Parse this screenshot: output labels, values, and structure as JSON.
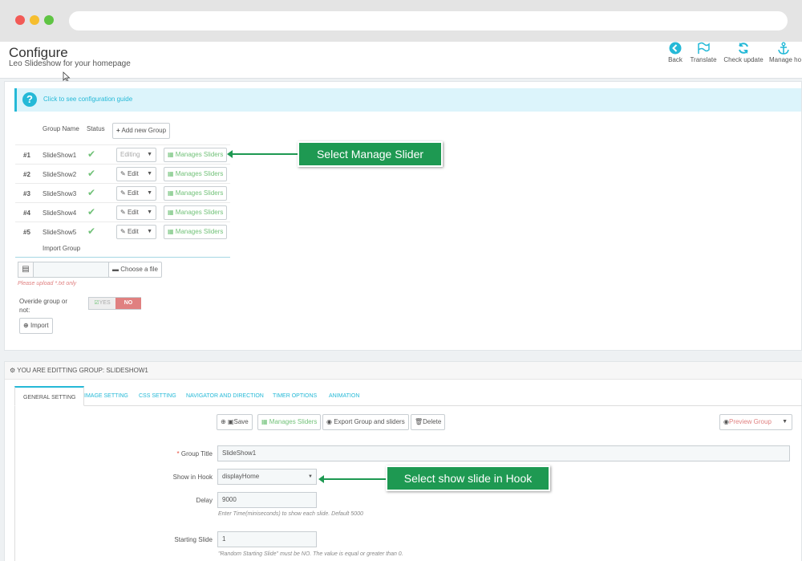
{
  "header": {
    "title": "Configure",
    "subtitle": "Leo Slideshow for your homepage",
    "toolbar": [
      {
        "label": "Back",
        "icon": "back-arrow-icon"
      },
      {
        "label": "Translate",
        "icon": "flag-icon"
      },
      {
        "label": "Check update",
        "icon": "refresh-icon"
      },
      {
        "label": "Manage ho",
        "icon": "anchor-icon"
      }
    ]
  },
  "guide": {
    "link": "Click to see configuration guide"
  },
  "groups": {
    "col_name": "Group Name",
    "col_status": "Status",
    "add_label": "Add new Group",
    "editing_label": "Editing",
    "edit_label": "Edit",
    "manage_label": "Manages Sliders",
    "rows": [
      {
        "num": "#1",
        "name": "SlideShow1"
      },
      {
        "num": "#2",
        "name": "SlideShow2"
      },
      {
        "num": "#3",
        "name": "SlideShow3"
      },
      {
        "num": "#4",
        "name": "SlideShow4"
      },
      {
        "num": "#5",
        "name": "SlideShow5"
      }
    ]
  },
  "import": {
    "title": "Import Group",
    "choose_label": "Choose a file",
    "hint": "Please upload *.txt only",
    "override_label": "Overide group or not:",
    "yes": "YES",
    "no": "NO",
    "import_label": "Import"
  },
  "callouts": {
    "manage": "Select Manage Slider",
    "hook": "Select show slide in Hook"
  },
  "editing": {
    "heading": "YOU ARE EDITTING GROUP: SLIDESHOW1",
    "tabs": [
      "GENERAL SETTING",
      "IMAGE SETTING",
      "CSS SETTING",
      "NAVIGATOR AND DIRECTION",
      "TIMER OPTIONS",
      "ANIMATION"
    ],
    "actions": {
      "save": "Save",
      "manage": "Manages Sliders",
      "export": "Export Group and sliders",
      "delete": "Delete",
      "preview": "Preview Group"
    },
    "fields": {
      "group_title_label": "Group Title",
      "group_title_value": "SlideShow1",
      "hook_label": "Show in Hook",
      "hook_value": "displayHome",
      "delay_label": "Delay",
      "delay_value": "9000",
      "delay_help": "Enter Time(miniseconds) to show each slide. Default 5000",
      "start_label": "Starting Slide",
      "start_value": "1",
      "start_help": "\"Random Starting Slide\" must be NO. The value is equal or greater than 0."
    }
  },
  "colors": {
    "accent": "#25b9d7",
    "success": "#72c279",
    "callout": "#1e9952",
    "danger": "#e08080"
  }
}
